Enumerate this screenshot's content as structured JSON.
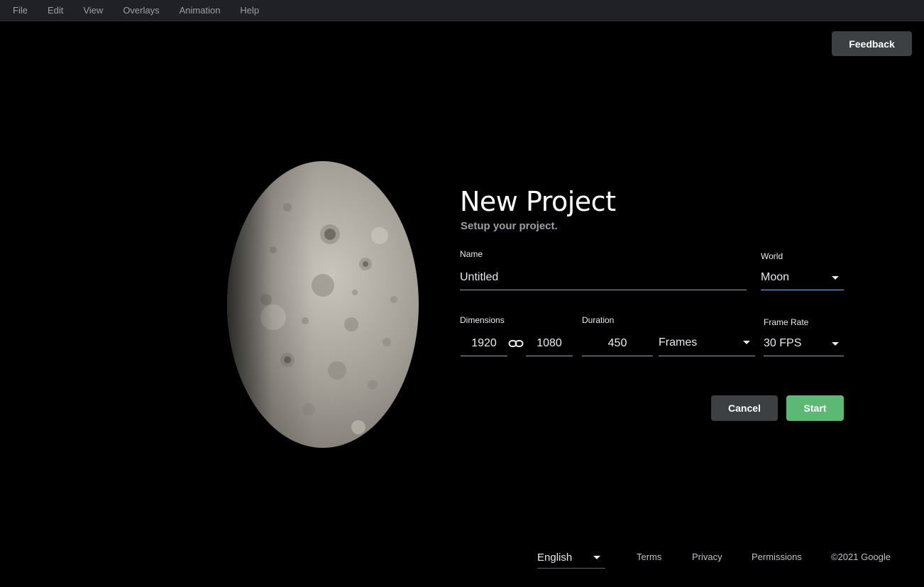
{
  "menu": [
    "File",
    "Edit",
    "View",
    "Overlays",
    "Animation",
    "Help"
  ],
  "feedback_label": "Feedback",
  "form": {
    "title": "New Project",
    "subtitle": "Setup your project.",
    "name_label": "Name",
    "name_value": "Untitled",
    "world_label": "World",
    "world_value": "Moon",
    "dimensions_label": "Dimensions",
    "width": "1920",
    "height": "1080",
    "link_icon": "link-icon",
    "duration_label": "Duration",
    "duration_value": "450",
    "duration_unit": "Frames",
    "framerate_label": "Frame Rate",
    "framerate_value": "30 FPS",
    "cancel_label": "Cancel",
    "start_label": "Start"
  },
  "footer": {
    "language": "English",
    "terms": "Terms",
    "privacy": "Privacy",
    "permissions": "Permissions",
    "copyright": "©2021 Google"
  },
  "colors": {
    "menubar_bg": "#202124",
    "button_dark": "#3c4043",
    "start_green": "#5bb974",
    "focus_blue": "#8ab4f8"
  }
}
